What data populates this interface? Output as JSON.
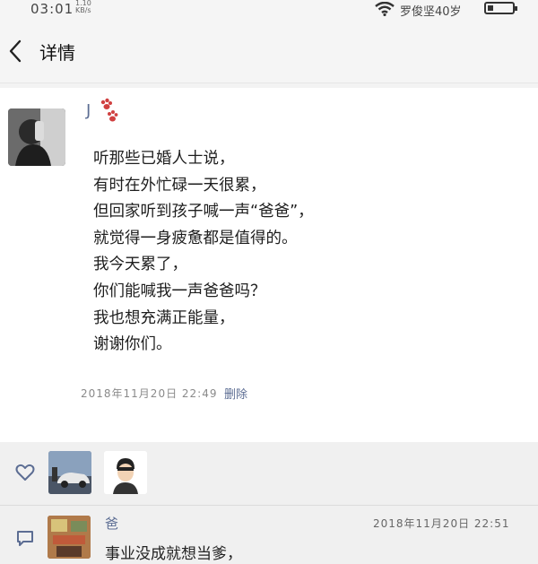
{
  "status_bar": {
    "time": "03:01",
    "speed_top": "1.10",
    "speed_unit": "KB/s",
    "carrier": "罗俊坚40岁"
  },
  "header": {
    "title": "详情"
  },
  "post": {
    "author": "J",
    "lines": [
      "听那些已婚人士说，",
      "有时在外忙碌一天很累，",
      "但回家听到孩子喊一声“爸爸”，",
      "就觉得一身疲惫都是值得的。",
      "我今天累了，",
      "你们能喊我一声爸爸吗？",
      "我也想充满正能量，",
      "谢谢你们。"
    ],
    "timestamp": "2018年11月20日 22:49",
    "delete_label": "删除"
  },
  "comments": [
    {
      "author": "爸",
      "time": "2018年11月20日 22:51",
      "text": "事业没成就想当爹，"
    }
  ],
  "colors": {
    "link": "#5c6d93",
    "paw": "#d04040"
  },
  "icons": [
    "back-arrow-icon",
    "wifi-icon",
    "battery-icon",
    "paw-print-icon",
    "heart-outline-icon",
    "comment-bubble-icon"
  ]
}
